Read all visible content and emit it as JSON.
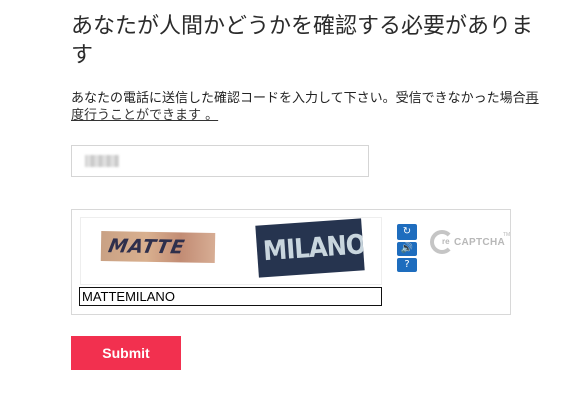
{
  "heading": "あなたが人間かどうかを確認する必要があります",
  "instructions": {
    "text": "あなたの電話に送信した確認コードを入力して下さい。受信できなかった場合",
    "resend_link": "再度行うことができます 。"
  },
  "verification_code": {
    "value": ""
  },
  "captcha": {
    "image_words": [
      "MATTE",
      "MILANO"
    ],
    "answer": "MATTEMILANO",
    "tools": {
      "refresh": "↻",
      "audio": "🔊",
      "help": "?"
    },
    "logo": {
      "re": "re",
      "text": "CAPTCHA",
      "tm": "TM"
    }
  },
  "submit_label": "Submit"
}
